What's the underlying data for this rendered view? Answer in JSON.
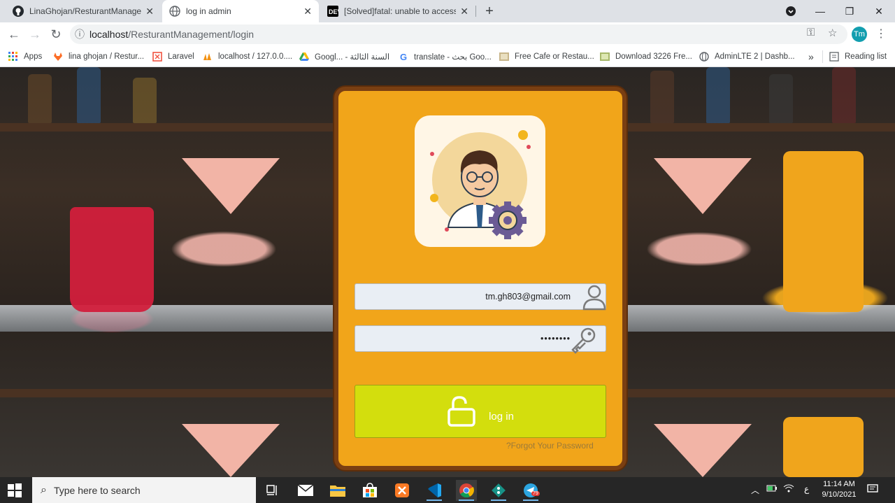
{
  "browser": {
    "tabs": [
      {
        "title": "LinaGhojan/ResturantManageme",
        "active": false
      },
      {
        "title": "log in admin",
        "active": true
      },
      {
        "title": "[Solved]fatal: unable to access : C",
        "active": false
      }
    ],
    "url_host": "localhost",
    "url_path": "/ResturantManagement/login",
    "profile_initials": "Tm"
  },
  "bookmarks": [
    {
      "label": "Apps",
      "icon": "apps-grid-icon"
    },
    {
      "label": "lina ghojan / Restur...",
      "icon": "gitlab-icon"
    },
    {
      "label": "Laravel",
      "icon": "laravel-icon"
    },
    {
      "label": "localhost / 127.0.0....",
      "icon": "phpmyadmin-icon"
    },
    {
      "label": "Googl... - السنة الثالثة",
      "icon": "google-drive-icon"
    },
    {
      "label": "translate - بحث Goo...",
      "icon": "google-icon"
    },
    {
      "label": "Free Cafe or Restau...",
      "icon": "image-icon"
    },
    {
      "label": "Download 3226 Fre...",
      "icon": "image-icon"
    },
    {
      "label": "AdminLTE 2 | Dashb...",
      "icon": "globe-icon"
    }
  ],
  "bookmarks_more": "»",
  "reading_list": "Reading list",
  "login": {
    "email_value": "tm.gh803@gmail.com",
    "password_value": "••••••••",
    "button_label": "log in",
    "forgot_label": "?Forgot Your Password"
  },
  "taskbar": {
    "search_placeholder": "Type here to search",
    "time": "11:14 AM",
    "date": "9/10/2021",
    "lang": "ع",
    "telegram_badge": "79"
  },
  "colors": {
    "card": "#f1a51a",
    "card_border": "#7a3f12",
    "button": "#d3de0d",
    "accent_teal": "#129eaf"
  }
}
